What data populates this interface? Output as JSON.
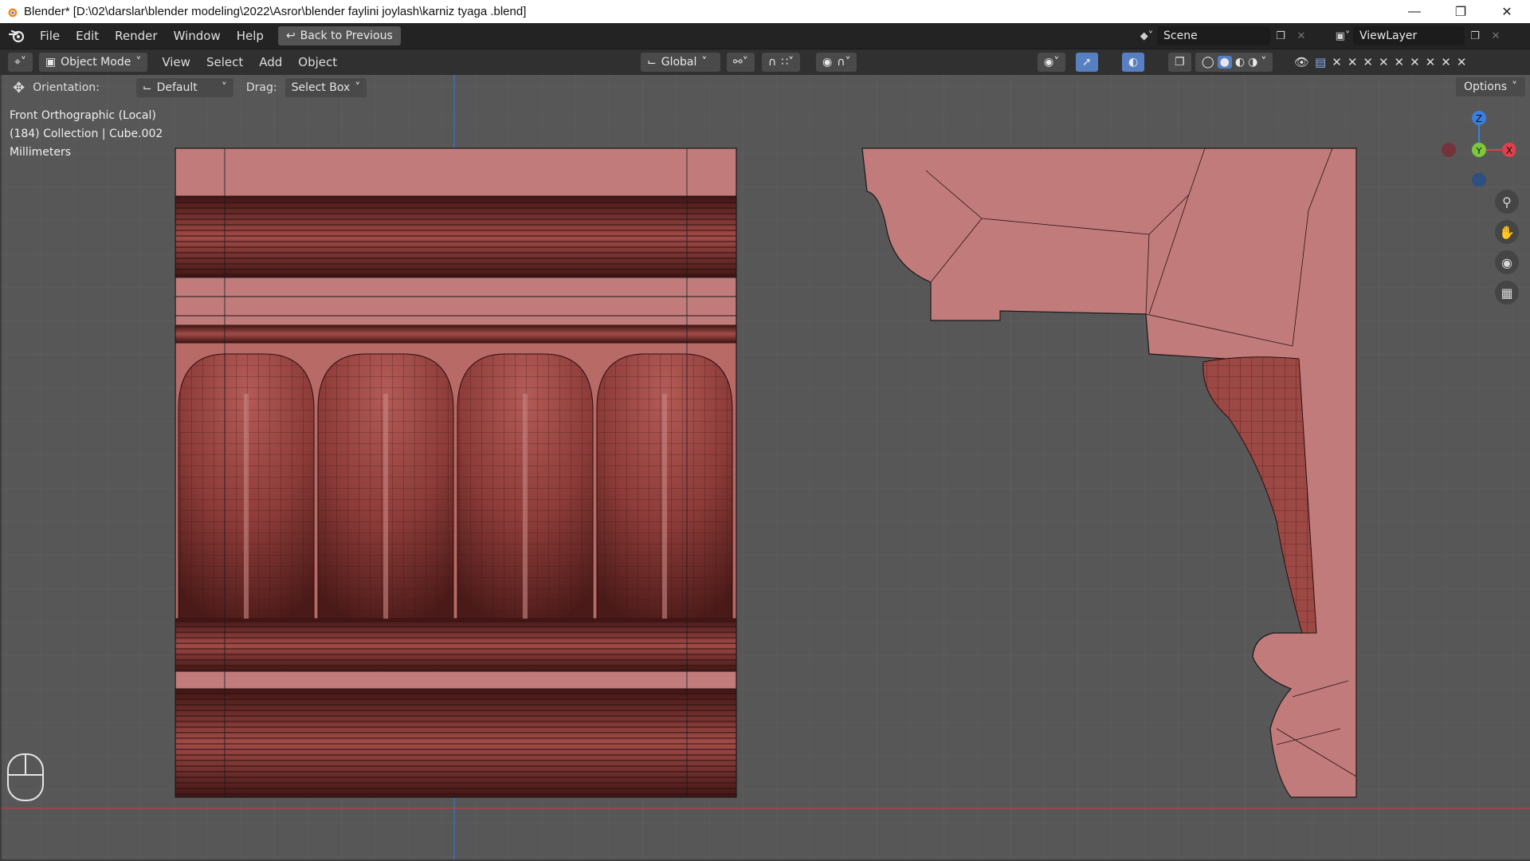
{
  "window": {
    "title": "Blender* [D:\\02\\darslar\\blender modeling\\2022\\Asror\\blender faylini joylash\\karniz tyaga .blend]",
    "minimize_icon": "minimize-icon",
    "maximize_icon": "restore-icon",
    "close_icon": "close-icon"
  },
  "topbar": {
    "menus": [
      "File",
      "Edit",
      "Render",
      "Window",
      "Help"
    ],
    "back_button": "Back to Previous",
    "scene": "Scene",
    "view_layer": "ViewLayer"
  },
  "header": {
    "mode": "Object Mode",
    "menus": [
      "View",
      "Select",
      "Add",
      "Object"
    ],
    "transform_orientation": "Global"
  },
  "toolsettings": {
    "orientation_label": "Orientation:",
    "orientation_value": "Default",
    "drag_label": "Drag:",
    "drag_value": "Select Box",
    "options_label": "Options"
  },
  "viewport": {
    "view_name": "Front Orthographic (Local)",
    "collection_info": "(184) Collection | Cube.002",
    "units": "Millimeters",
    "gizmo": {
      "z": "Z",
      "y": "Y",
      "x": "X"
    }
  },
  "colors": {
    "model": "#c27b7b",
    "model_dark": "#5e2624",
    "viewport_bg": "#575757",
    "x_axis": "#e0404a",
    "y_axis": "#7ac93a",
    "z_axis": "#3a7fe0"
  }
}
